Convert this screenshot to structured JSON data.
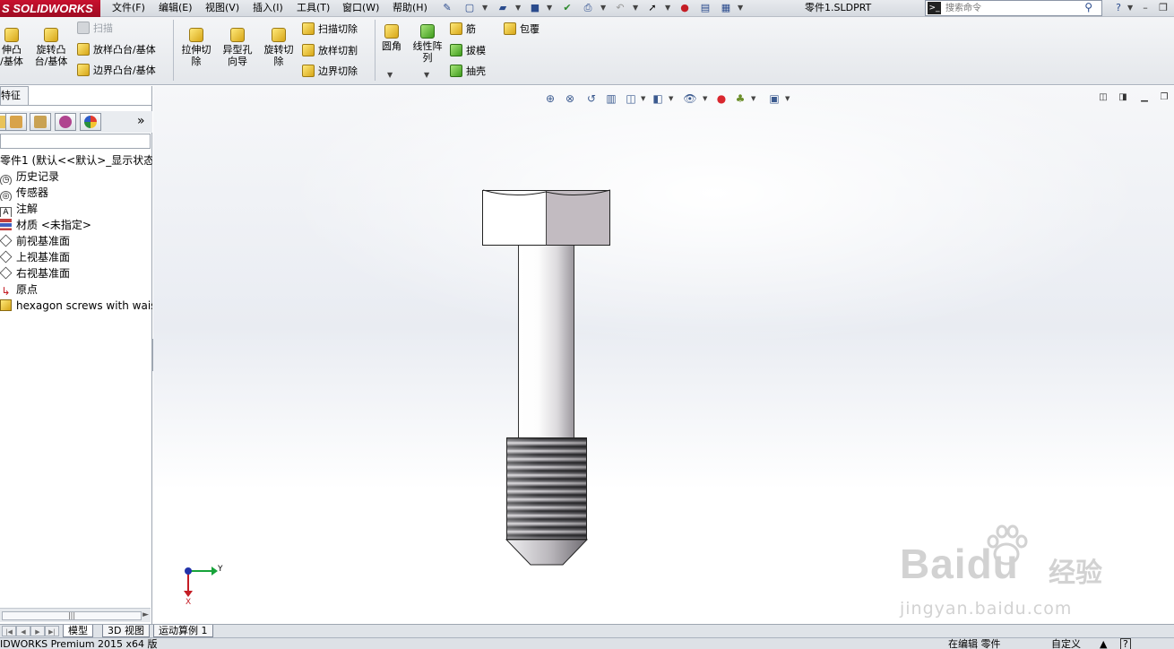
{
  "app": {
    "logo_text": "S SOLIDWORKS",
    "document_title": "零件1.SLDPRT"
  },
  "menu": [
    "文件(F)",
    "编辑(E)",
    "视图(V)",
    "插入(I)",
    "工具(T)",
    "窗口(W)",
    "帮助(H)"
  ],
  "search": {
    "placeholder": "搜索命令"
  },
  "ribbon": {
    "extrude_boss_line1": "伸凸",
    "extrude_boss_line2": "/基体",
    "revolve_boss_line1": "旋转凸",
    "revolve_boss_line2": "台/基体",
    "sweep": "扫描",
    "loft_boss": "放样凸台/基体",
    "boundary_boss": "边界凸台/基体",
    "extrude_cut_line1": "拉伸切",
    "extrude_cut_line2": "除",
    "hole_wizard_line1": "异型孔",
    "hole_wizard_line2": "向导",
    "revolve_cut_line1": "旋转切",
    "revolve_cut_line2": "除",
    "swept_cut": "扫描切除",
    "lofted_cut": "放样切割",
    "boundary_cut": "边界切除",
    "fillet": "圆角",
    "linear_pattern_line1": "线性阵",
    "linear_pattern_line2": "列",
    "rib": "筋",
    "draft": "拔模",
    "shell": "抽壳",
    "wrap": "包覆"
  },
  "left_panel": {
    "tab_label": "特征",
    "tree": {
      "root": "零件1  (默认<<默认>_显示状态",
      "items": [
        {
          "label": "历史记录",
          "icon": "history-icon"
        },
        {
          "label": "传感器",
          "icon": "sensor-icon"
        },
        {
          "label": "注解",
          "icon": "annotation-icon"
        },
        {
          "label": "材质 <未指定>",
          "icon": "material-icon"
        },
        {
          "label": "前视基准面",
          "icon": "plane-icon"
        },
        {
          "label": "上视基准面",
          "icon": "plane-icon"
        },
        {
          "label": "右视基准面",
          "icon": "plane-icon"
        },
        {
          "label": "原点",
          "icon": "origin-icon"
        },
        {
          "label": "hexagon screws with waist",
          "icon": "part-feature-icon"
        }
      ]
    }
  },
  "bottom_tabs": [
    "模型",
    "3D 视图",
    "运动算例 1"
  ],
  "status": {
    "left": "IDWORKS Premium 2015 x64 版",
    "mode": "在编辑 零件",
    "custom": "自定义",
    "help": "?"
  },
  "triad": {
    "x_label": "X",
    "y_label": "Y"
  },
  "watermark": {
    "brand": "Baidu",
    "sub": "经验",
    "url": "jingyan.baidu.com"
  },
  "colors": {
    "brand_red": "#c8102e",
    "triad_x": "#c41d25",
    "triad_y": "#17a33a",
    "bolt_head_shade": "#c2bbc1"
  }
}
